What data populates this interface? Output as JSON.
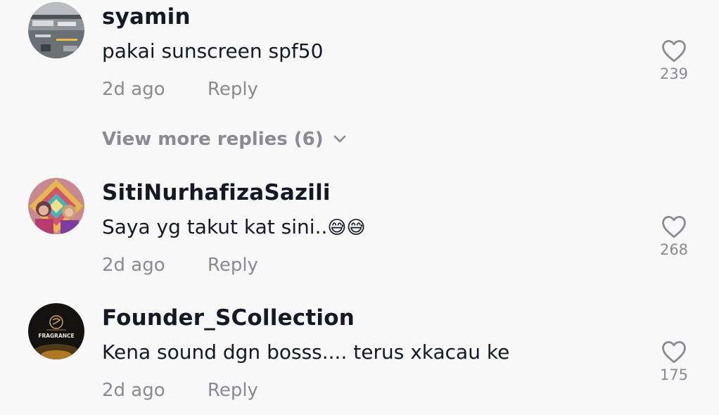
{
  "comments": [
    {
      "username": "syamin",
      "text": "pakai sunscreen spf50",
      "time": "2d ago",
      "reply_label": "Reply",
      "likes": "239"
    },
    {
      "username": "SitiNurhafizaSazili",
      "text": "Saya yg takut kat sini..",
      "emoji": "😅😅",
      "time": "2d ago",
      "reply_label": "Reply",
      "likes": "268"
    },
    {
      "username": "Founder_SCollection",
      "text": "Kena sound dgn bosss.... terus xkacau ke",
      "avatar_text": "FRAGRANCE",
      "time": "2d ago",
      "reply_label": "Reply",
      "likes": "175"
    }
  ],
  "view_more_replies": "View more replies (6)",
  "icons": {
    "like": "heart-outline-icon",
    "expand": "chevron-down-icon"
  },
  "colors": {
    "background": "#f8f8f8",
    "primary_text": "#161823",
    "secondary_text": "#8a8b91"
  }
}
